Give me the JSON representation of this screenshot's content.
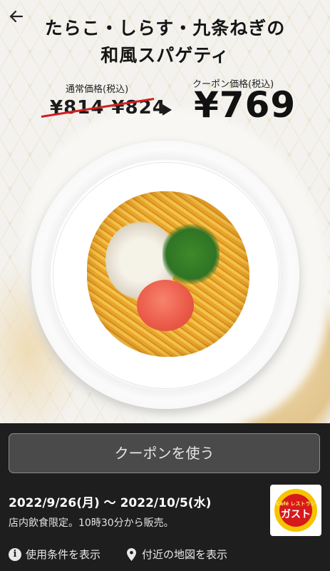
{
  "nav": {
    "back_icon": "back-arrow-icon"
  },
  "coupon": {
    "title_line1": "たらこ・しらす・九条ねぎの",
    "title_line2": "和風スパゲティ",
    "regular_label": "通常価格(税込)",
    "regular_price": "¥814 ¥824",
    "coupon_label": "クーポン価格(税込)",
    "coupon_price": "¥769",
    "colors": {
      "strike": "#d21f1f",
      "pattern_gold": "#e2c58e"
    }
  },
  "actions": {
    "use_button": "クーポンを使う"
  },
  "validity": {
    "dates": "2022/9/26(月) 〜 2022/10/5(水)",
    "note": "店内飲食限定。10時30分から販売。"
  },
  "logo": {
    "cafe": "Café レストラン",
    "name": "ガスト",
    "colors": {
      "ring": "#f6c400",
      "disc": "#d7191c"
    }
  },
  "links": {
    "conditions": "使用条件を表示",
    "conditions_icon": "info-icon",
    "map": "付近の地図を表示",
    "map_icon": "location-pin-icon"
  }
}
